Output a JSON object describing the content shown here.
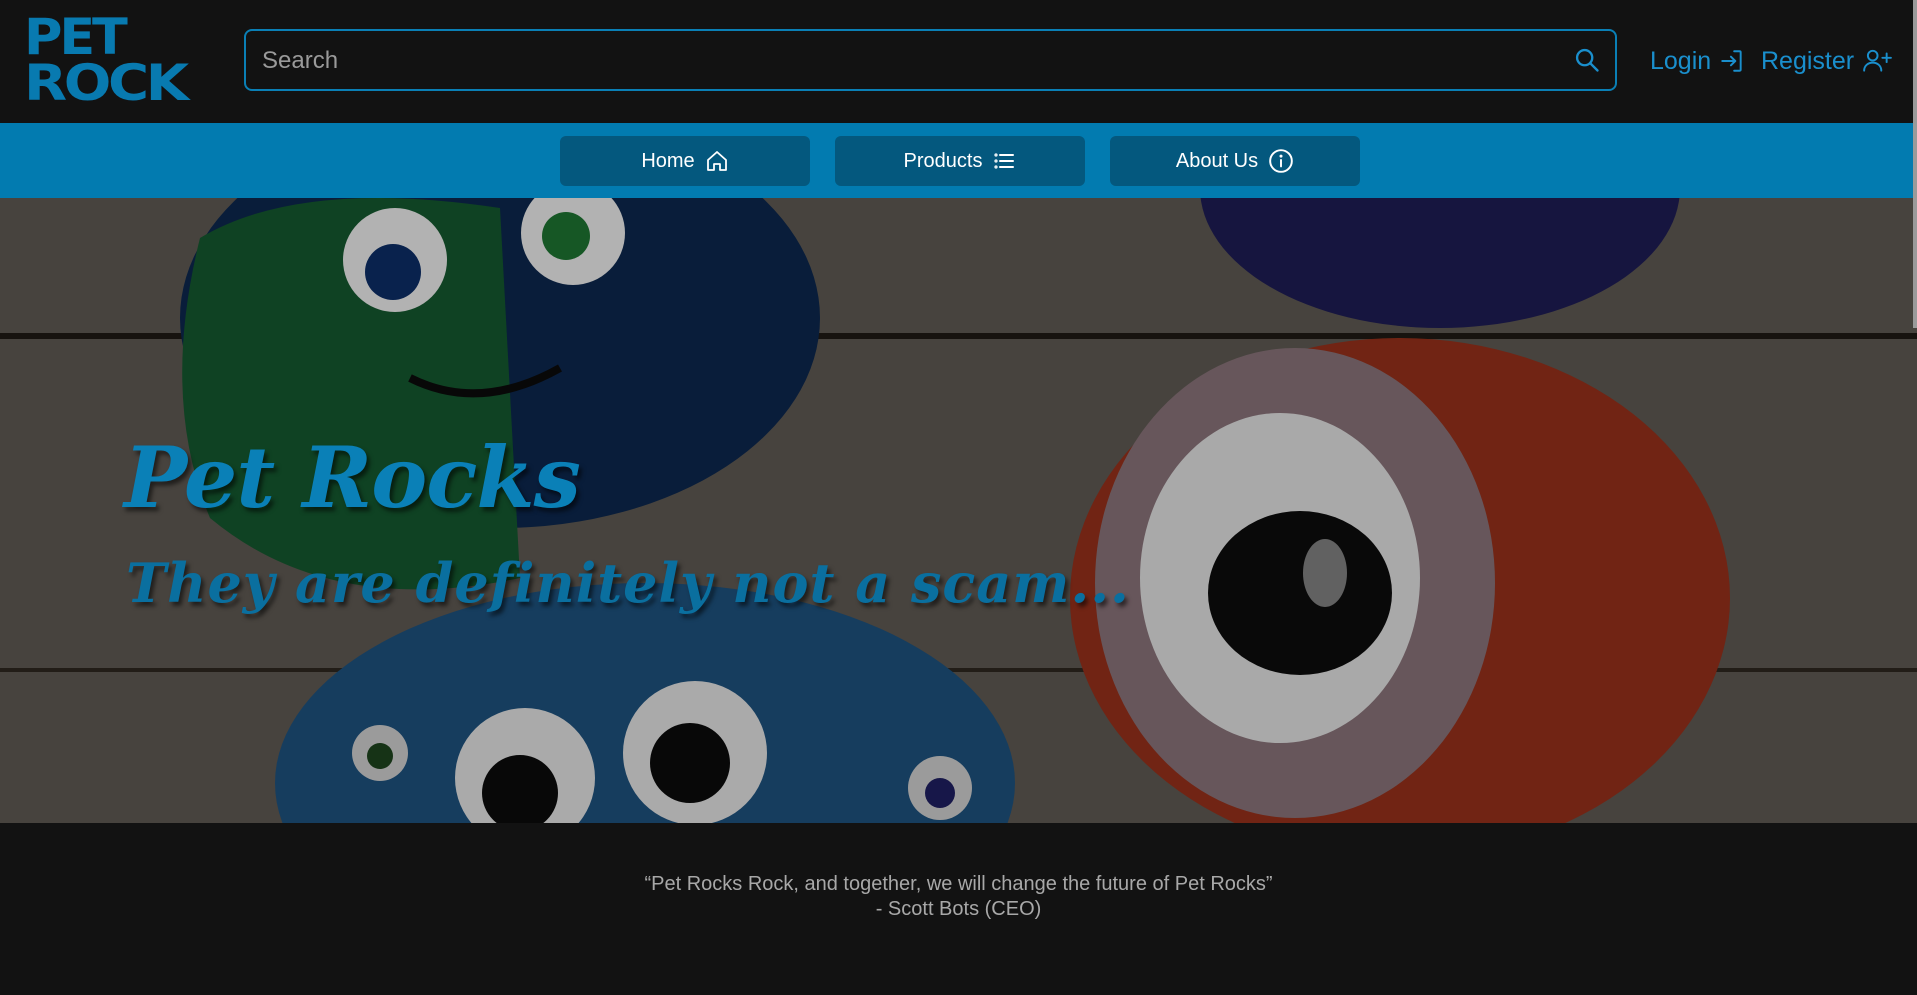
{
  "brand": {
    "logo_line1": "PET",
    "logo_line2": "ROCK"
  },
  "search": {
    "placeholder": "Search"
  },
  "auth": {
    "login_label": "Login",
    "register_label": "Register"
  },
  "nav": {
    "home_label": "Home",
    "products_label": "Products",
    "about_label": "About Us"
  },
  "hero": {
    "title": "Pet Rocks",
    "subtitle": "They are definitely not a scam..."
  },
  "quote": {
    "text": "“Pet Rocks Rock, and together, we will change the future of Pet Rocks”",
    "author": "- Scott Bots (CEO)"
  },
  "colors": {
    "accent": "#027bb0",
    "nav_button": "#04587e",
    "background": "#121212",
    "link": "#1a8fcd"
  },
  "icons": {
    "search": "search-icon",
    "login": "login-arrow-icon",
    "register": "user-plus-icon",
    "home": "home-icon",
    "products": "list-icon",
    "about": "info-icon"
  }
}
